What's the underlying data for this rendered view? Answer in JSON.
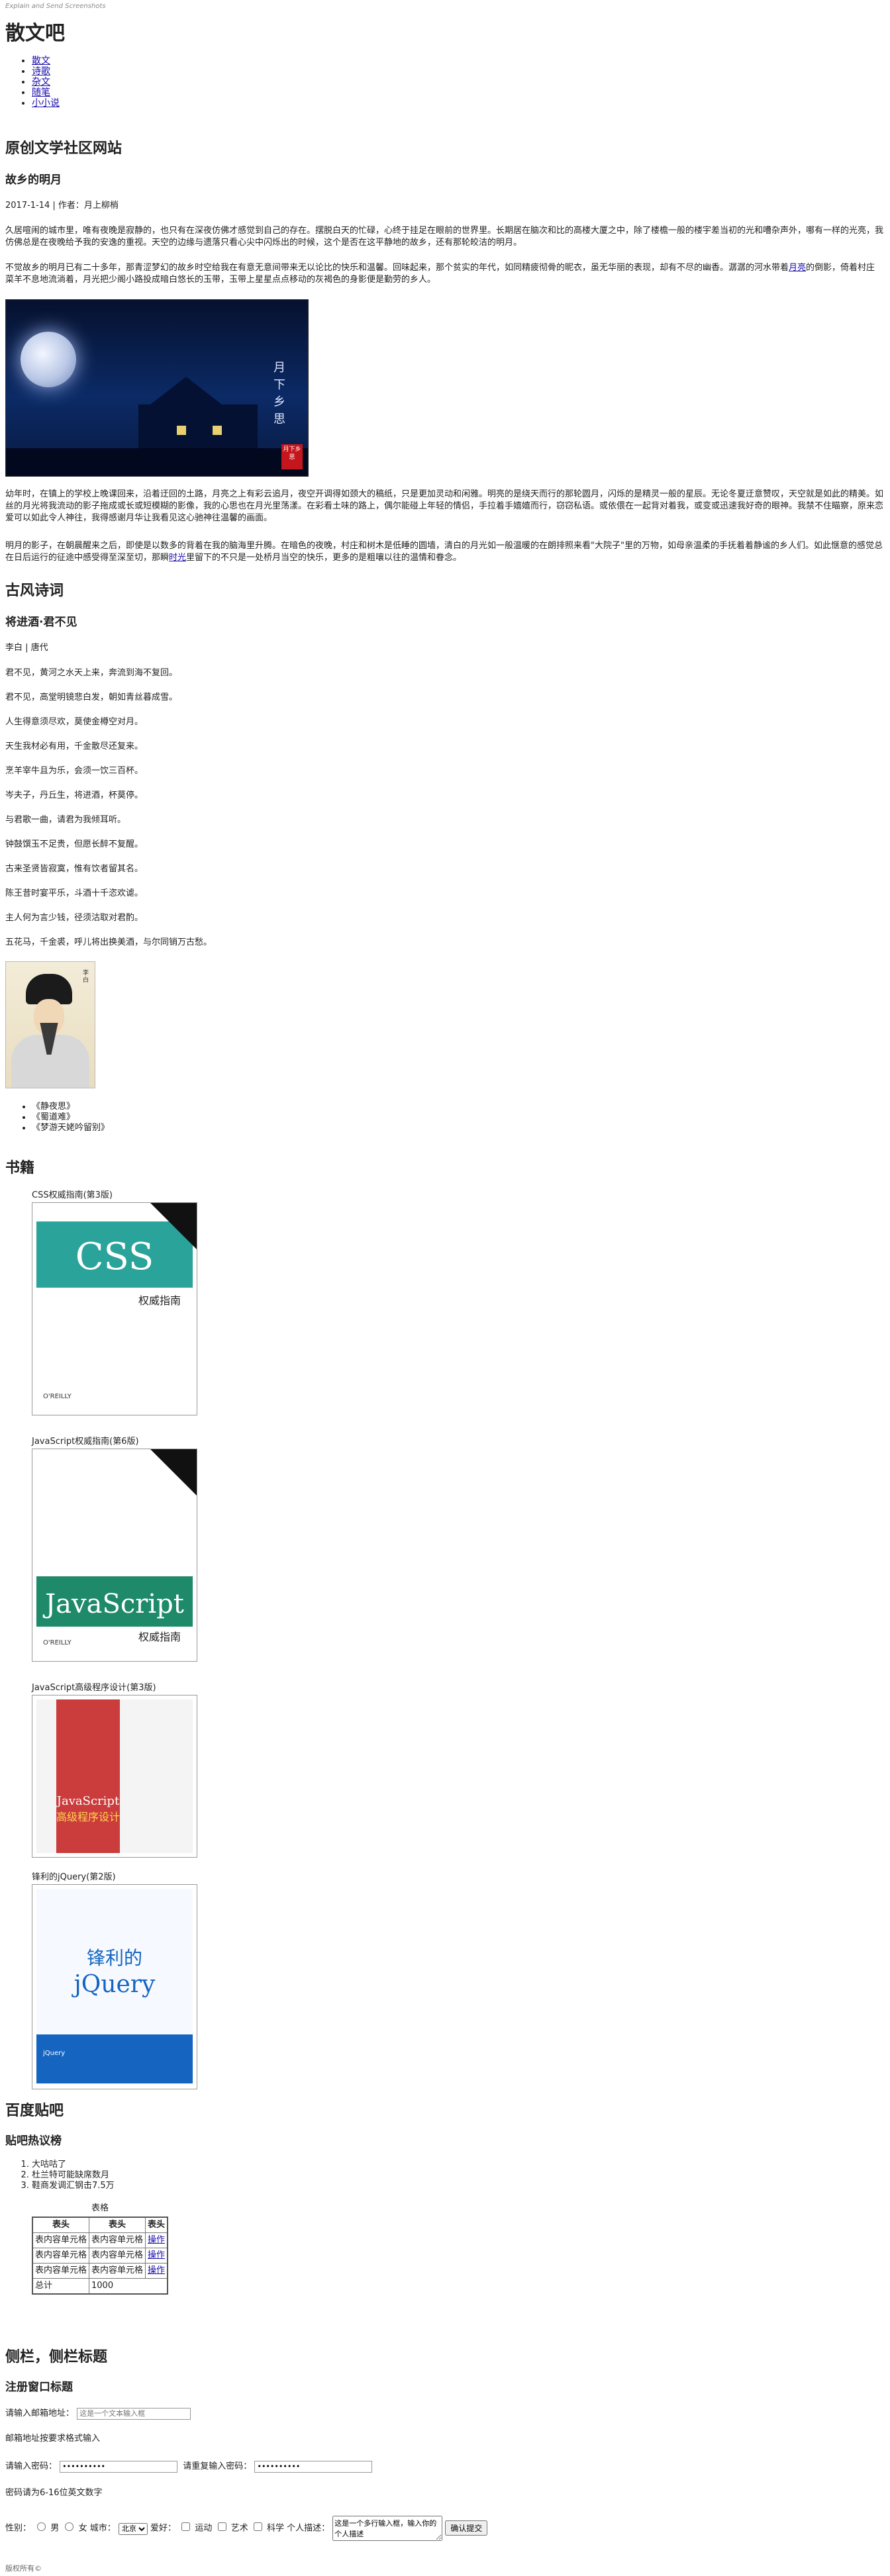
{
  "topnote": "Explain and Send Screenshots",
  "site_title": "散文吧",
  "nav": [
    "散文",
    "诗歌",
    "杂文",
    "随笔",
    "小小说"
  ],
  "section1": {
    "heading": "原创文学社区网站",
    "article_title": "故乡的明月",
    "meta": "2017-1-14 | 作者：月上柳梢",
    "p1": "久居喧闹的城市里，唯有夜晚是寂静的，也只有在深夜仿佛才感觉到自己的存在。摆脱白天的忙碌，心终于挂足在眼前的世界里。长期居在脑次和比的高楼大厦之中，除了楼檐一般的楼宇差当初的光和嘈杂声外，哪有一样的光亮，我仿佛总是在夜晚给予我的安逸的重视。天空的边缘与遗落只看心尖中闪烁出的时候，这个是否在这平静地的故乡，还有那轮皎洁的明月。",
    "p2": "不觉故乡的明月已有二十多年，那青涩梦幻的故乡时空给我在有意无意间带来无以论比的快乐和温馨。回味起来，那个贫实的年代，如同精疲彻骨的昵衣，虽无华丽的表现，却有不尽的幽香。潺潺的河水带着月亮的倒影，倚着村庄菜羊不息地流淌着，月光把少阁小路投成暗白悠长的玉带，玉带上星星点点移动的灰褐色的身影便是勤劳的乡人。",
    "p2_link": "月亮",
    "moon_caption": "月下乡思",
    "moon_seal": "月下乡思",
    "p3": "幼年时，在镇上的学校上晚课回来，沿着迂回的土路，月亮之上有彩云追月，夜空开调得如颈大的稿纸，只是更加灵动和闲雅。明亮的是绕天而行的那轮圆月，闪烁的是精灵一般的星辰。无论冬夏迂意赞叹，天空就是如此的精美。如丝的月光将我流动的影子拖成或长或短模糊的影像，我的心思也在月光里荡漾。在彩看土味的路上，偶尔能碰上年轻的情侣，手拉着手嬉嬉而行，窃窃私语。或依偎在一起背对着我，或变或迅速我好奇的眼神。我禁不住瞄察，原来恋爱可以如此令人神往，我得感谢月华让我看见这心驰神往温馨的画面。",
    "p4": "明月的影子，在朝晨醒来之后，即使是以数多的背着在我的脑海里升腾。在暗色的夜晚，村庄和树木是低睡的圆墙，清白的月光如一般温暖的在朗排照来看\"大院子\"里的万物，如母亲温柔的手抚着着静谧的乡人们。如此惬意的感觉总在日后运行的征途中感受得至深至切，那瞬时光里留下的不只是一处桥月当空的快乐，更多的是粗嚷以往的温情和眷念。",
    "p4_link": "时光"
  },
  "section2": {
    "heading": "古风诗词",
    "poem_title": "将进酒·君不见",
    "author": "李白 | 唐代",
    "lines": [
      "君不见，黄河之水天上来，奔流到海不复回。",
      "君不见，高堂明镜悲白发，朝如青丝暮成雪。",
      "人生得意须尽欢，莫使金樽空对月。",
      "天生我材必有用，千金散尽还复来。",
      "烹羊宰牛且为乐，会须一饮三百杯。",
      "岑夫子，丹丘生，将进酒，杯莫停。",
      "与君歌一曲，请君为我倾耳听。",
      "钟鼓馔玉不足贵，但愿长醉不复醒。",
      "古来圣贤皆寂寞，惟有饮者留其名。",
      "陈王昔时宴平乐，斗酒十千恣欢谑。",
      "主人何为言少钱，径须沽取对君酌。",
      "五花马，千金裘，呼儿将出换美酒，与尔同销万古愁。"
    ],
    "portrait_text": "李白",
    "related": [
      "《静夜思》",
      "《蜀道难》",
      "《梦游天姥吟留别》"
    ]
  },
  "section3": {
    "heading": "书籍",
    "books": [
      {
        "label": "CSS权威指南(第3版)",
        "cover_title": "CSS",
        "cover_sub": "权威指南",
        "publisher": "O'REILLY",
        "color": "#2aa39a"
      },
      {
        "label": "JavaScript权威指南(第6版)",
        "cover_title": "JavaScript",
        "cover_sub": "权威指南",
        "publisher": "O'REILLY",
        "color": "#1e8a6a"
      },
      {
        "label": "JavaScript高级程序设计(第3版)",
        "cover_title": "JavaScript",
        "cover_sub": "高级程序设计",
        "publisher": "",
        "color": "#c62828"
      },
      {
        "label": "锋利的jQuery(第2版)",
        "cover_title": "锋利的",
        "cover_sub": "jQuery",
        "publisher": "jQuery",
        "color": "#1565c0"
      }
    ]
  },
  "section4": {
    "heading": "百度贴吧",
    "sub": "贴吧热议榜",
    "hot": [
      "大咕咕了",
      "杜兰特可能缺席数月",
      "鞋商发调汇钢击7.5万"
    ],
    "table": {
      "caption": "表格",
      "headers": [
        "表头",
        "表头",
        "表头"
      ],
      "rows": [
        [
          "表内容单元格",
          "表内容单元格",
          "操作"
        ],
        [
          "表内容单元格",
          "表内容单元格",
          "操作"
        ],
        [
          "表内容单元格",
          "表内容单元格",
          "操作"
        ]
      ],
      "total_label": "总计",
      "total_value": "1000"
    }
  },
  "section5": {
    "heading": "侧栏，侧栏标题",
    "sub": "注册窗口标题",
    "email_label": "请输入邮箱地址：",
    "email_placeholder": "这是一个文本输入框",
    "email_hint": "邮箱地址按要求格式输入",
    "pwd_label": "请输入密码：",
    "pwd_value": "••••••••••",
    "pwd2_label": "请重复输入密码：",
    "pwd2_value": "••••••••••",
    "pwd_hint": "密码请为6-16位英文数字",
    "gender_label": "性别：",
    "male": "男",
    "female": "女",
    "city_label": "城市：",
    "city_value": "北京",
    "hobby_label": "爱好：",
    "hobbies": [
      "运动",
      "艺术",
      "科学"
    ],
    "desc_label": "个人描述：",
    "desc_value": "这是一个多行输入框，输入你的个人描述",
    "submit": "确认提交"
  },
  "footer": "版权所有©"
}
